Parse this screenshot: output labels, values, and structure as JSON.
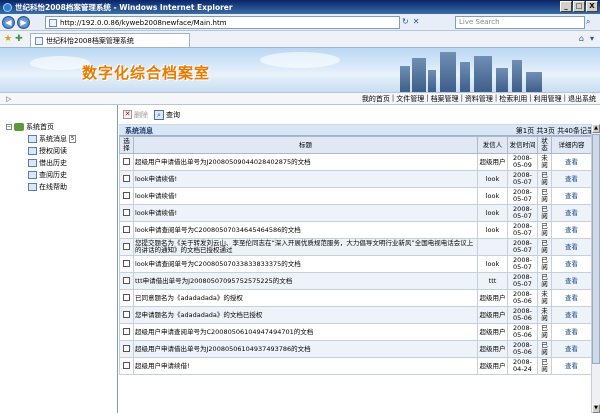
{
  "window": {
    "title": "世纪科怡2008档案管理系统 - Windows Internet Explorer",
    "controls": {
      "minimize": "_",
      "maximize": "□",
      "close": "X"
    }
  },
  "browser": {
    "address": "http://192.0.0.86/kyweb2008newface/Main.htm",
    "search_placeholder": "Live Search",
    "tab_title": "世纪科怡2008档案管理系统",
    "icons": [
      "back-icon",
      "forward-icon",
      "refresh-icon",
      "stop-icon",
      "search-icon",
      "favorites-icon",
      "add-favorites-icon",
      "home-icon",
      "page-icon"
    ]
  },
  "banner": {
    "title": "数字化综合档案室"
  },
  "menu": {
    "items": [
      "我的首页",
      "文件管理",
      "档案管理",
      "资料管理",
      "检索利用",
      "利用管理",
      "退出系统"
    ]
  },
  "tree": {
    "root": "系统首页",
    "children": [
      {
        "label": "系统消息",
        "badge": "5"
      },
      {
        "label": "授权阅读"
      },
      {
        "label": "借出历史"
      },
      {
        "label": "查阅历史"
      },
      {
        "label": "在线帮助"
      }
    ]
  },
  "toolbar": {
    "delete_label": "删除",
    "search_label": "查询"
  },
  "section": {
    "title": "系统消息",
    "pager": "第1页 共3页 共40条记录"
  },
  "table": {
    "headers": {
      "select": "选择",
      "title": "标题",
      "sender": "发信人",
      "date": "发信时间",
      "status": "状态",
      "detail": "详细内容"
    },
    "rows": [
      {
        "title": "超级用户申请借出单号为J2008050904402840287​5的文档",
        "sender": "超级用户",
        "date": "2008-05-09",
        "status": "未阅",
        "detail": "查看"
      },
      {
        "title": "look申请续借!",
        "sender": "look",
        "date": "2008-05-07",
        "status": "已阅",
        "detail": "查看"
      },
      {
        "title": "look申请续借!",
        "sender": "look",
        "date": "2008-05-07",
        "status": "已阅",
        "detail": "查看"
      },
      {
        "title": "look申请续借!",
        "sender": "look",
        "date": "2008-05-07",
        "status": "已阅",
        "detail": "查看"
      },
      {
        "title": "look申请查阅单号为C20080507034645464586的文档",
        "sender": "look",
        "date": "2008-05-07",
        "status": "已阅",
        "detail": "查看"
      },
      {
        "title": "您提交题名为《关于转发刘云山、李至伦同志在“深入开展优质规范服务，大力倡导文明行业新风”全国电视电话会议上的讲话的通知》的文档已授权通过",
        "sender": "",
        "date": "2008-05-07",
        "status": "已阅",
        "detail": "查看"
      },
      {
        "title": "look申请查阅单号为C20080507033833833375的文档",
        "sender": "look",
        "date": "2008-05-07",
        "status": "已阅",
        "detail": "查看"
      },
      {
        "title": "ttt申请借出单号为J20080507095752575225的文档",
        "sender": "ttt",
        "date": "2008-05-07",
        "status": "已阅",
        "detail": "查看"
      },
      {
        "title": "已同意题名为《adadadada》的授权",
        "sender": "超级用户",
        "date": "2008-05-06",
        "status": "未阅",
        "detail": "查看"
      },
      {
        "title": "您申请题名为《adadadada》的文档已授权",
        "sender": "超级用户",
        "date": "2008-05-06",
        "status": "未阅",
        "detail": "查看"
      },
      {
        "title": "超级用户申请查阅单号为C20080506104947494701的文档",
        "sender": "超级用户",
        "date": "2008-05-06",
        "status": "已阅",
        "detail": "查看"
      },
      {
        "title": "超级用户申请借出单号为J20080506104937493786的文档",
        "sender": "超级用户",
        "date": "2008-05-06",
        "status": "已阅",
        "detail": "查看"
      },
      {
        "title": "超级用户申请续借!",
        "sender": "超级用户",
        "date": "2008-04-24",
        "status": "已阅",
        "detail": "查看"
      }
    ]
  }
}
